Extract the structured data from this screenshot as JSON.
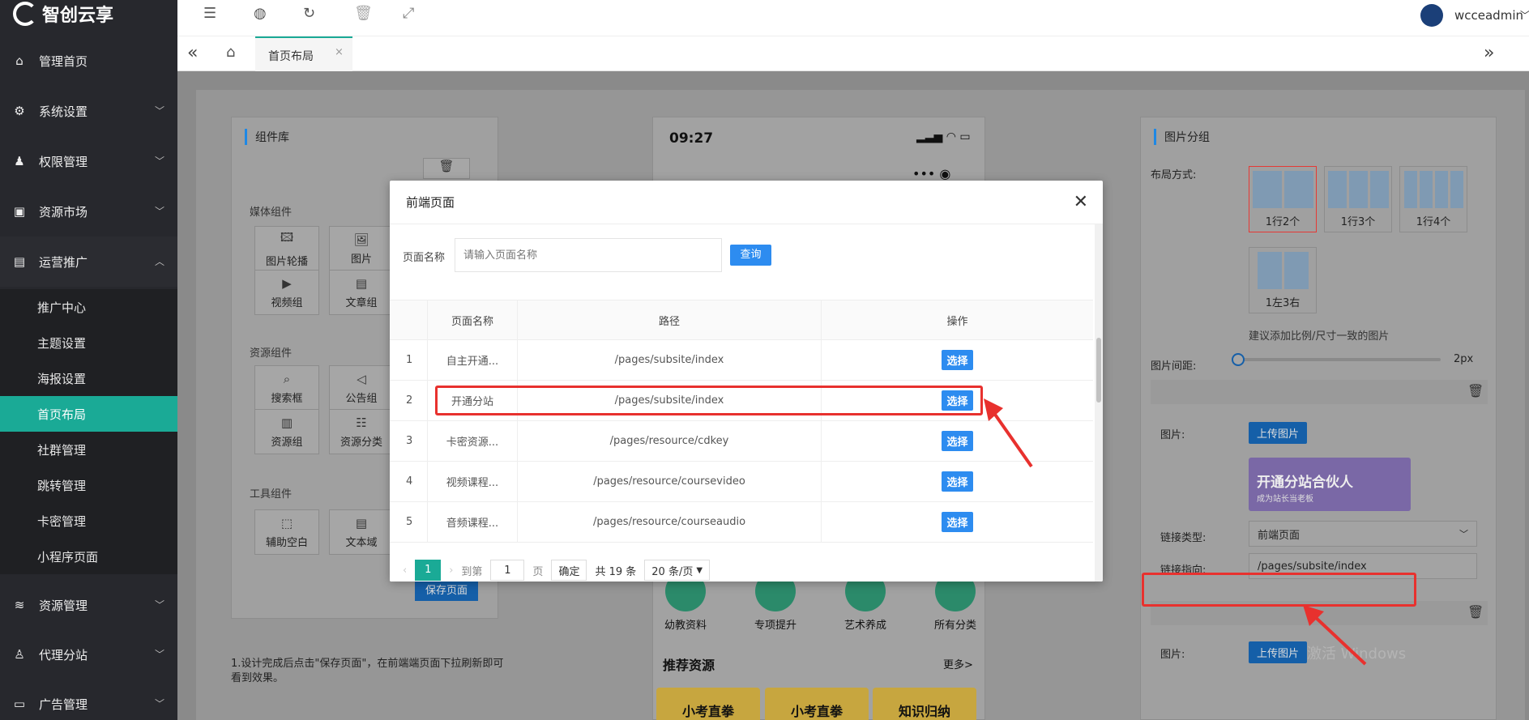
{
  "brand": {
    "name": "智创云享"
  },
  "sidebar": {
    "items": [
      {
        "label": "管理首页",
        "icon": "home-icon"
      },
      {
        "label": "系统设置",
        "icon": "gear-icon"
      },
      {
        "label": "权限管理",
        "icon": "users-icon"
      },
      {
        "label": "资源市场",
        "icon": "store-icon"
      },
      {
        "label": "运营推广",
        "icon": "promo-icon"
      }
    ],
    "sub_items": [
      "推广中心",
      "主题设置",
      "海报设置",
      "首页布局",
      "社群管理",
      "跳转管理",
      "卡密管理",
      "小程序页面"
    ],
    "active_sub": "首页布局",
    "bottom_items": [
      {
        "label": "资源管理",
        "icon": "layers-icon"
      },
      {
        "label": "代理分站",
        "icon": "agent-icon"
      },
      {
        "label": "广告管理",
        "icon": "ad-icon"
      }
    ]
  },
  "topbar": {
    "user": "wcceadmin"
  },
  "tabs": {
    "active": "首页布局"
  },
  "left_panel": {
    "title": "组件库",
    "media_group": "媒体组件",
    "media": [
      "图片轮播",
      "图片",
      "视频组",
      "文章组"
    ],
    "resource_group": "资源组件",
    "resources": [
      "搜索框",
      "公告组",
      "资源组",
      "资源分类"
    ],
    "tool_group": "工具组件",
    "tools": [
      "辅助空白",
      "文本域"
    ],
    "save_label": "保存页面",
    "note": "1.设计完成后点击\"保存页面\"，在前端端页面下拉刷新即可看到效果。"
  },
  "phone": {
    "time": "09:27",
    "categories": [
      "幼教资料",
      "专项提升",
      "艺术养成",
      "所有分类"
    ],
    "rec_title": "推荐资源",
    "more": "更多>",
    "cards": [
      "小考直拳",
      "小考直拳",
      "知识归纳"
    ]
  },
  "right_panel": {
    "title": "图片分组",
    "layout_label": "布局方式:",
    "layouts": [
      "1行2个",
      "1行3个",
      "1行4个",
      "1左3右"
    ],
    "hint": "建议添加比例/尺寸一致的图片",
    "spacing_label": "图片间距:",
    "spacing_value": "2px",
    "image_label": "图片:",
    "upload_label": "上传图片",
    "banner_title": "开通分站合伙人",
    "banner_sub": "成为站长当老板",
    "link_type_label": "链接类型:",
    "link_type_value": "前端页面",
    "link_target_label": "链接指向:",
    "link_target_value": "/pages/subsite/index",
    "image_label2": "图片:",
    "upload_label2": "上传图片"
  },
  "modal": {
    "title": "前端页面",
    "search_label": "页面名称",
    "search_placeholder": "请输入页面名称",
    "query_label": "查询",
    "columns": [
      "页面名称",
      "路径",
      "操作"
    ],
    "rows": [
      {
        "no": "1",
        "name": "自主开通...",
        "path": "/pages/subsite/index",
        "action": "选择"
      },
      {
        "no": "2",
        "name": "开通分站",
        "path": "/pages/subsite/index",
        "action": "选择"
      },
      {
        "no": "3",
        "name": "卡密资源...",
        "path": "/pages/resource/cdkey",
        "action": "选择"
      },
      {
        "no": "4",
        "name": "视频课程...",
        "path": "/pages/resource/coursevideo",
        "action": "选择"
      },
      {
        "no": "5",
        "name": "音频课程...",
        "path": "/pages/resource/courseaudio",
        "action": "选择"
      }
    ],
    "pager": {
      "current": "1",
      "goto_label": "到第",
      "goto_value": "1",
      "page_unit": "页",
      "confirm": "确定",
      "total": "共 19 条",
      "page_size": "20 条/页"
    }
  },
  "watermark": "激活 Windows"
}
